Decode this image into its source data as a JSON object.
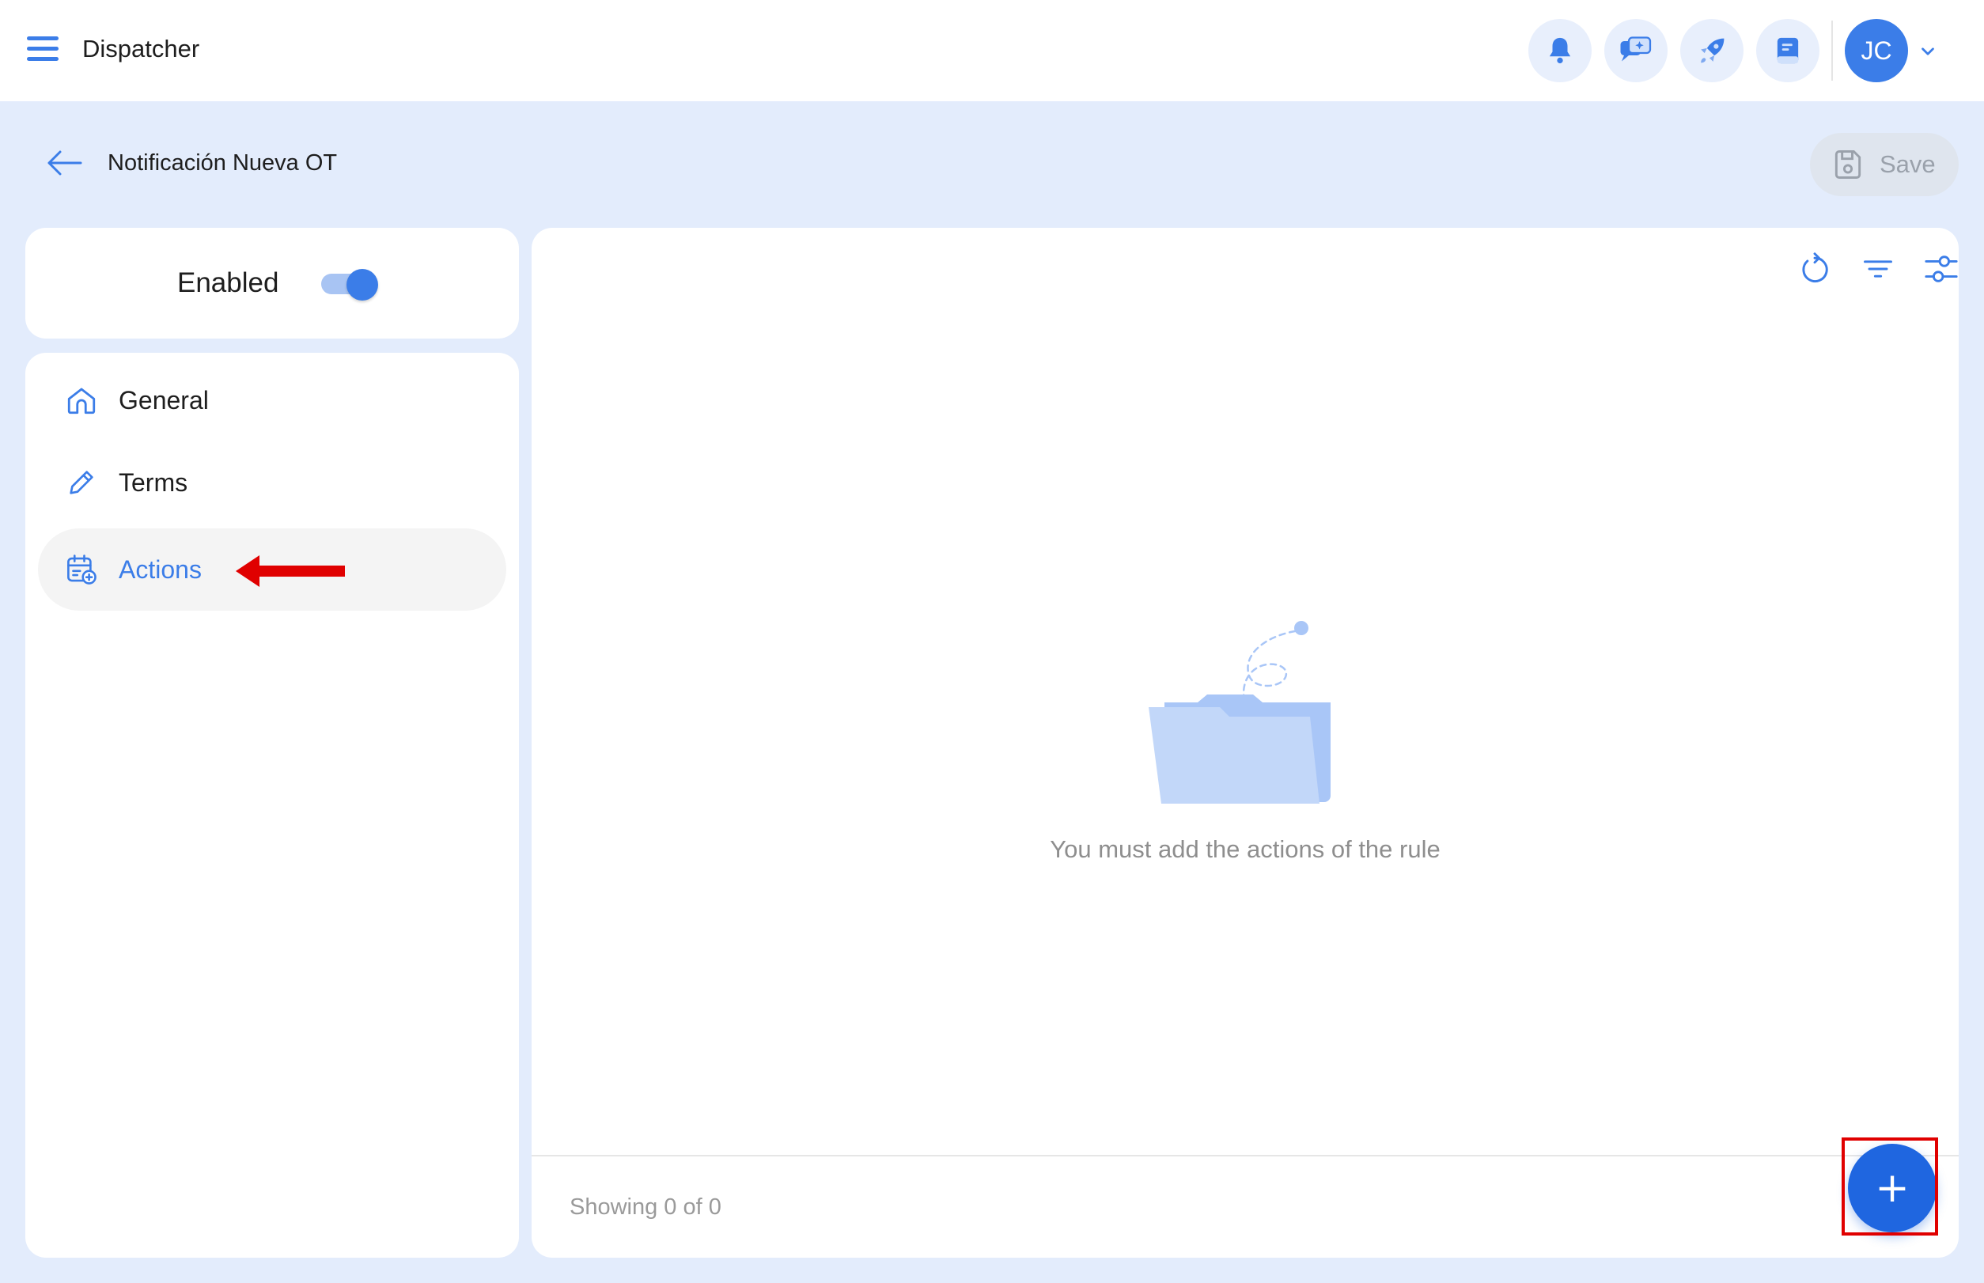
{
  "topbar": {
    "app_title": "Dispatcher",
    "icons": [
      "bell-icon",
      "chat-sparkle-icon",
      "rocket-icon",
      "book-icon"
    ],
    "user_initials": "JC"
  },
  "subheader": {
    "title": "Notificación Nueva OT",
    "save_label": "Save"
  },
  "left": {
    "enabled_label": "Enabled",
    "enabled_on": true,
    "nav": [
      {
        "label": "General",
        "icon": "home-icon"
      },
      {
        "label": "Terms",
        "icon": "pencil-icon"
      },
      {
        "label": "Actions",
        "icon": "calendar-add-icon",
        "active": true
      }
    ]
  },
  "main": {
    "toolbar_icons": [
      "refresh-icon",
      "filter-icon",
      "sliders-icon"
    ],
    "empty_message": "You must add the actions of the rule",
    "showing_text": "Showing 0 of 0",
    "fab_icon": "plus-icon"
  },
  "colors": {
    "accent": "#3b7de8",
    "background": "#e3ecfc",
    "annotation_red": "#e00000"
  }
}
